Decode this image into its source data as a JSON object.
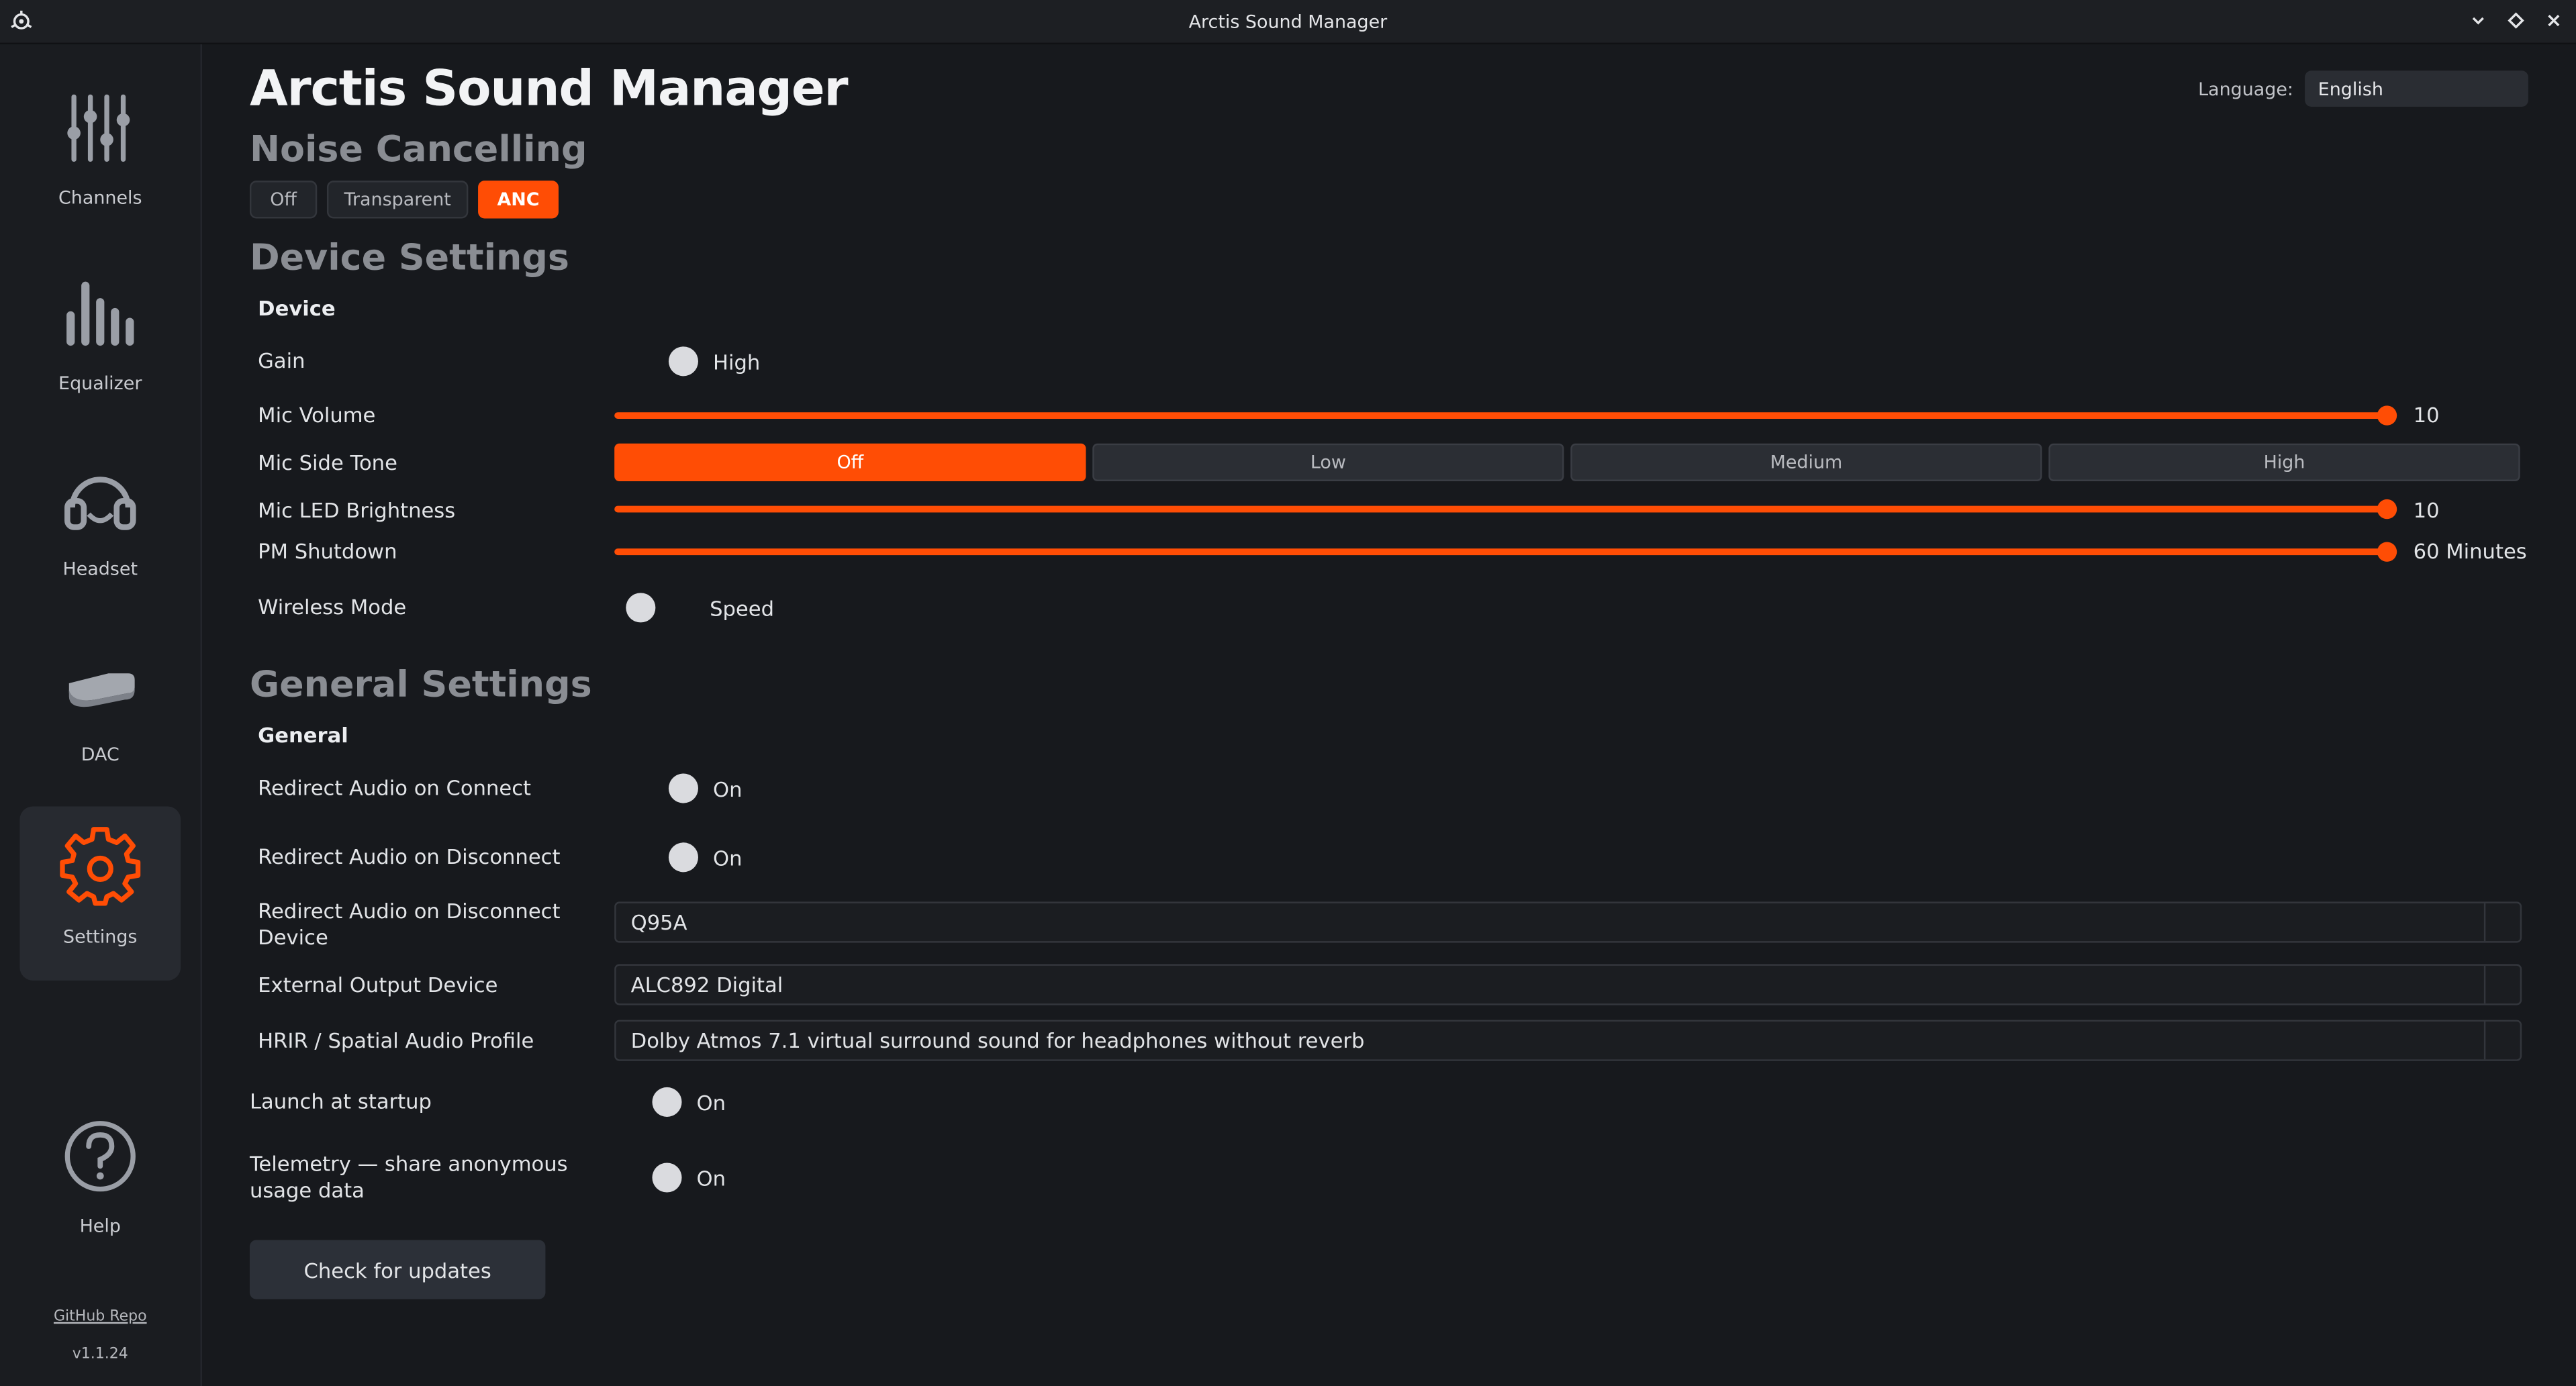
{
  "window": {
    "title": "Arctis Sound Manager"
  },
  "sidebar": {
    "items": [
      {
        "label": "Channels",
        "icon": "sliders-icon"
      },
      {
        "label": "Equalizer",
        "icon": "equalizer-bars-icon"
      },
      {
        "label": "Headset",
        "icon": "headset-icon"
      },
      {
        "label": "DAC",
        "icon": "dac-icon"
      },
      {
        "label": "Settings",
        "icon": "gear-icon",
        "active": true
      },
      {
        "label": "Help",
        "icon": "help-icon"
      }
    ],
    "github_link": "GitHub Repo",
    "version": "v1.1.24"
  },
  "header": {
    "title": "Arctis Sound Manager",
    "language_label": "Language:",
    "language_value": "English"
  },
  "noise_cancelling": {
    "title": "Noise Cancelling",
    "options": [
      "Off",
      "Transparent",
      "ANC"
    ],
    "selected": "ANC"
  },
  "device_settings": {
    "title": "Device Settings",
    "subtitle": "Device",
    "gain": {
      "label": "Gain",
      "value": "High"
    },
    "mic_volume": {
      "label": "Mic Volume",
      "value": "10",
      "fraction": 1.0
    },
    "mic_side_tone": {
      "label": "Mic Side Tone",
      "options": [
        "Off",
        "Low",
        "Medium",
        "High"
      ],
      "selected": "Off"
    },
    "mic_led_brightness": {
      "label": "Mic LED Brightness",
      "value": "10",
      "fraction": 1.0
    },
    "pm_shutdown": {
      "label": "PM Shutdown",
      "value": "60 Minutes",
      "fraction": 1.0
    },
    "wireless_mode": {
      "label": "Wireless Mode",
      "value": "Speed"
    }
  },
  "general_settings": {
    "title": "General Settings",
    "subtitle": "General",
    "redirect_connect": {
      "label": "Redirect Audio on Connect",
      "value": "On"
    },
    "redirect_disconnect": {
      "label": "Redirect Audio on Disconnect",
      "value": "On"
    },
    "redirect_disconnect_device": {
      "label_line1": "Redirect Audio on Disconnect",
      "label_line2": "Device",
      "value": "Q95A"
    },
    "external_output_device": {
      "label": "External Output Device",
      "value": "ALC892 Digital"
    },
    "hrir_profile": {
      "label": "HRIR / Spatial Audio Profile",
      "value": "Dolby Atmos 7.1 virtual surround sound for headphones without reverb"
    },
    "launch_at_startup": {
      "label": "Launch at startup",
      "value": "On"
    },
    "telemetry": {
      "label_line1": "Telemetry — share anonymous",
      "label_line2": "usage data",
      "value": "On"
    },
    "check_updates": "Check for updates"
  },
  "colors": {
    "accent": "#ff4d05",
    "background": "#17191d",
    "sidebar": "#1a1c20"
  }
}
